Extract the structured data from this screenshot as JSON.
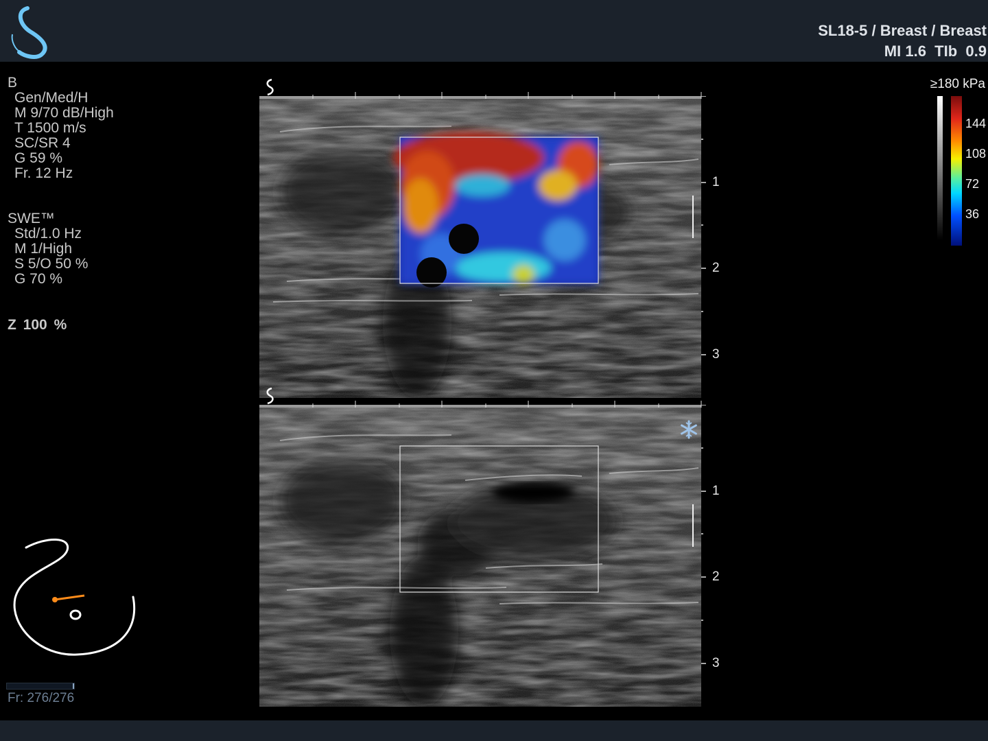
{
  "header": {
    "preset": "SL18-5 / Breast / Breast",
    "mi_label": "MI",
    "mi_value": "1.6",
    "tib_label": "TIb",
    "tib_value": "0.9"
  },
  "bmode_params": {
    "title": "B",
    "lines": [
      "Gen/Med/H",
      "M 9/70 dB/High",
      "T 1500 m/s",
      "SC/SR 4",
      "G 59 %",
      "Fr. 12 Hz"
    ]
  },
  "swe_params": {
    "title": "SWE™",
    "lines": [
      "Std/1.0 Hz",
      "M 1/High",
      "S 5/O 50 %",
      "G 70 %"
    ]
  },
  "zoom": {
    "label": "Z",
    "value": "100",
    "unit": "%"
  },
  "depth_scale": {
    "labels": [
      "1",
      "2",
      "3"
    ]
  },
  "colorbar": {
    "title": "≥180 kPa",
    "labels": [
      "144",
      "108",
      "72",
      "36"
    ],
    "max_kpa": 180
  },
  "frame": {
    "text": "Fr: 276/276",
    "current": 276,
    "total": 276
  },
  "icons": {
    "logo": "supersonic-logo-icon",
    "probe_mark_top": "probe-orientation-icon",
    "probe_mark_bottom": "probe-orientation-icon",
    "freeze": "snowflake-freeze-icon",
    "body_marker": "breast-body-marker-icon"
  },
  "colors": {
    "topbar": "#1b222b",
    "logo": "#6ec6f5",
    "freeze": "#9fc4ea",
    "probe_line": "#ff8c1a",
    "frame_text": "#6d7f94"
  }
}
